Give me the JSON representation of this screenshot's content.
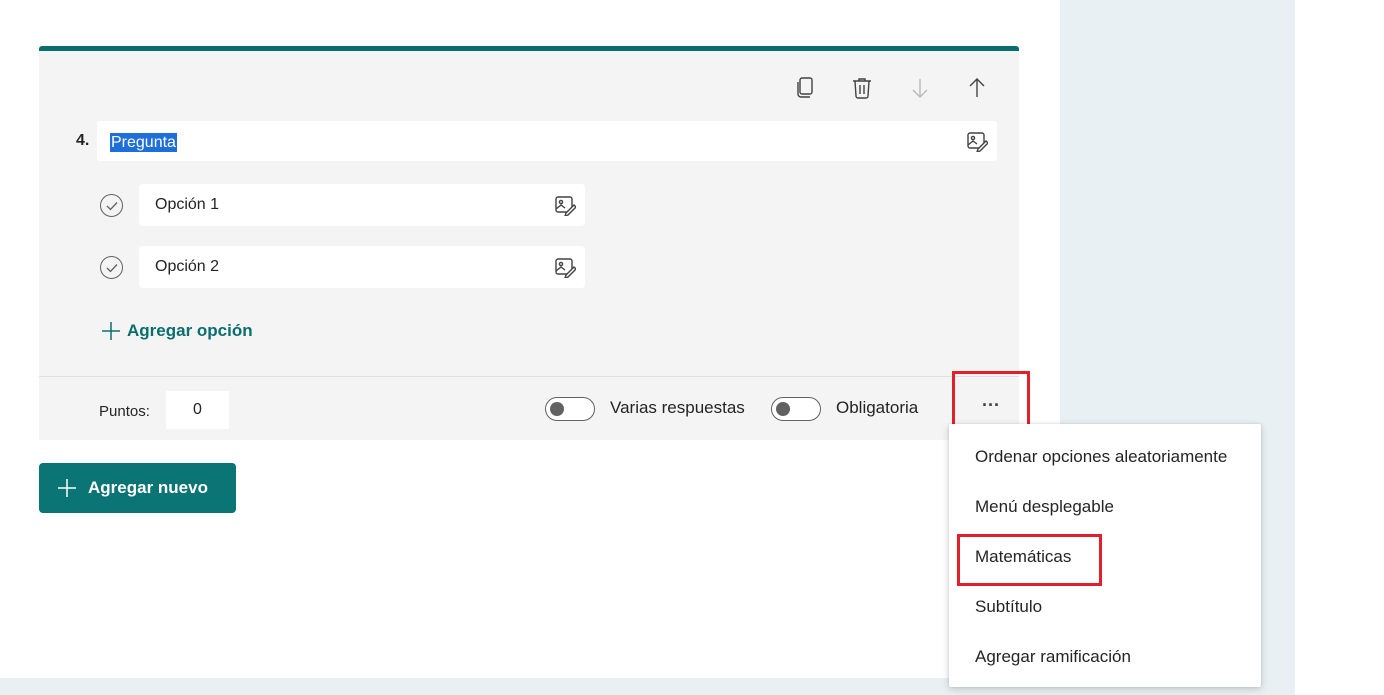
{
  "question": {
    "number": "4.",
    "title": "Pregunta",
    "options": [
      {
        "label": "Opción 1"
      },
      {
        "label": "Opción 2"
      }
    ],
    "add_option_label": "Agregar opción"
  },
  "footer": {
    "points_label": "Puntos:",
    "points_value": "0",
    "multiple_answers_label": "Varias respuestas",
    "required_label": "Obligatoria",
    "more_label": "..."
  },
  "add_new_label": "Agregar nuevo",
  "more_menu": {
    "items": [
      {
        "label": "Ordenar opciones aleatoriamente"
      },
      {
        "label": "Menú desplegable"
      },
      {
        "label": "Matemáticas"
      },
      {
        "label": "Subtítulo"
      },
      {
        "label": "Agregar ramificación"
      }
    ]
  },
  "colors": {
    "accent": "#0b6e6e",
    "highlight": "#e0202b",
    "panel": "#e8f0f3"
  },
  "toolbar": {
    "icons": [
      "copy-icon",
      "delete-icon",
      "move-down-icon",
      "move-up-icon"
    ]
  }
}
